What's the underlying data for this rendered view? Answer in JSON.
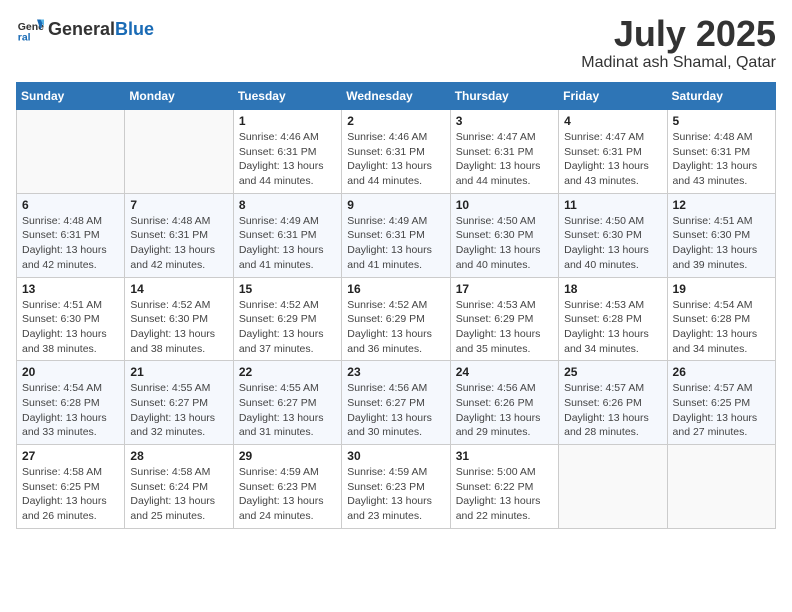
{
  "logo": {
    "general": "General",
    "blue": "Blue"
  },
  "title": {
    "month": "July 2025",
    "location": "Madinat ash Shamal, Qatar"
  },
  "weekdays": [
    "Sunday",
    "Monday",
    "Tuesday",
    "Wednesday",
    "Thursday",
    "Friday",
    "Saturday"
  ],
  "weeks": [
    [
      {
        "day": null
      },
      {
        "day": null
      },
      {
        "day": "1",
        "sunrise": "Sunrise: 4:46 AM",
        "sunset": "Sunset: 6:31 PM",
        "daylight": "Daylight: 13 hours and 44 minutes."
      },
      {
        "day": "2",
        "sunrise": "Sunrise: 4:46 AM",
        "sunset": "Sunset: 6:31 PM",
        "daylight": "Daylight: 13 hours and 44 minutes."
      },
      {
        "day": "3",
        "sunrise": "Sunrise: 4:47 AM",
        "sunset": "Sunset: 6:31 PM",
        "daylight": "Daylight: 13 hours and 44 minutes."
      },
      {
        "day": "4",
        "sunrise": "Sunrise: 4:47 AM",
        "sunset": "Sunset: 6:31 PM",
        "daylight": "Daylight: 13 hours and 43 minutes."
      },
      {
        "day": "5",
        "sunrise": "Sunrise: 4:48 AM",
        "sunset": "Sunset: 6:31 PM",
        "daylight": "Daylight: 13 hours and 43 minutes."
      }
    ],
    [
      {
        "day": "6",
        "sunrise": "Sunrise: 4:48 AM",
        "sunset": "Sunset: 6:31 PM",
        "daylight": "Daylight: 13 hours and 42 minutes."
      },
      {
        "day": "7",
        "sunrise": "Sunrise: 4:48 AM",
        "sunset": "Sunset: 6:31 PM",
        "daylight": "Daylight: 13 hours and 42 minutes."
      },
      {
        "day": "8",
        "sunrise": "Sunrise: 4:49 AM",
        "sunset": "Sunset: 6:31 PM",
        "daylight": "Daylight: 13 hours and 41 minutes."
      },
      {
        "day": "9",
        "sunrise": "Sunrise: 4:49 AM",
        "sunset": "Sunset: 6:31 PM",
        "daylight": "Daylight: 13 hours and 41 minutes."
      },
      {
        "day": "10",
        "sunrise": "Sunrise: 4:50 AM",
        "sunset": "Sunset: 6:30 PM",
        "daylight": "Daylight: 13 hours and 40 minutes."
      },
      {
        "day": "11",
        "sunrise": "Sunrise: 4:50 AM",
        "sunset": "Sunset: 6:30 PM",
        "daylight": "Daylight: 13 hours and 40 minutes."
      },
      {
        "day": "12",
        "sunrise": "Sunrise: 4:51 AM",
        "sunset": "Sunset: 6:30 PM",
        "daylight": "Daylight: 13 hours and 39 minutes."
      }
    ],
    [
      {
        "day": "13",
        "sunrise": "Sunrise: 4:51 AM",
        "sunset": "Sunset: 6:30 PM",
        "daylight": "Daylight: 13 hours and 38 minutes."
      },
      {
        "day": "14",
        "sunrise": "Sunrise: 4:52 AM",
        "sunset": "Sunset: 6:30 PM",
        "daylight": "Daylight: 13 hours and 38 minutes."
      },
      {
        "day": "15",
        "sunrise": "Sunrise: 4:52 AM",
        "sunset": "Sunset: 6:29 PM",
        "daylight": "Daylight: 13 hours and 37 minutes."
      },
      {
        "day": "16",
        "sunrise": "Sunrise: 4:52 AM",
        "sunset": "Sunset: 6:29 PM",
        "daylight": "Daylight: 13 hours and 36 minutes."
      },
      {
        "day": "17",
        "sunrise": "Sunrise: 4:53 AM",
        "sunset": "Sunset: 6:29 PM",
        "daylight": "Daylight: 13 hours and 35 minutes."
      },
      {
        "day": "18",
        "sunrise": "Sunrise: 4:53 AM",
        "sunset": "Sunset: 6:28 PM",
        "daylight": "Daylight: 13 hours and 34 minutes."
      },
      {
        "day": "19",
        "sunrise": "Sunrise: 4:54 AM",
        "sunset": "Sunset: 6:28 PM",
        "daylight": "Daylight: 13 hours and 34 minutes."
      }
    ],
    [
      {
        "day": "20",
        "sunrise": "Sunrise: 4:54 AM",
        "sunset": "Sunset: 6:28 PM",
        "daylight": "Daylight: 13 hours and 33 minutes."
      },
      {
        "day": "21",
        "sunrise": "Sunrise: 4:55 AM",
        "sunset": "Sunset: 6:27 PM",
        "daylight": "Daylight: 13 hours and 32 minutes."
      },
      {
        "day": "22",
        "sunrise": "Sunrise: 4:55 AM",
        "sunset": "Sunset: 6:27 PM",
        "daylight": "Daylight: 13 hours and 31 minutes."
      },
      {
        "day": "23",
        "sunrise": "Sunrise: 4:56 AM",
        "sunset": "Sunset: 6:27 PM",
        "daylight": "Daylight: 13 hours and 30 minutes."
      },
      {
        "day": "24",
        "sunrise": "Sunrise: 4:56 AM",
        "sunset": "Sunset: 6:26 PM",
        "daylight": "Daylight: 13 hours and 29 minutes."
      },
      {
        "day": "25",
        "sunrise": "Sunrise: 4:57 AM",
        "sunset": "Sunset: 6:26 PM",
        "daylight": "Daylight: 13 hours and 28 minutes."
      },
      {
        "day": "26",
        "sunrise": "Sunrise: 4:57 AM",
        "sunset": "Sunset: 6:25 PM",
        "daylight": "Daylight: 13 hours and 27 minutes."
      }
    ],
    [
      {
        "day": "27",
        "sunrise": "Sunrise: 4:58 AM",
        "sunset": "Sunset: 6:25 PM",
        "daylight": "Daylight: 13 hours and 26 minutes."
      },
      {
        "day": "28",
        "sunrise": "Sunrise: 4:58 AM",
        "sunset": "Sunset: 6:24 PM",
        "daylight": "Daylight: 13 hours and 25 minutes."
      },
      {
        "day": "29",
        "sunrise": "Sunrise: 4:59 AM",
        "sunset": "Sunset: 6:23 PM",
        "daylight": "Daylight: 13 hours and 24 minutes."
      },
      {
        "day": "30",
        "sunrise": "Sunrise: 4:59 AM",
        "sunset": "Sunset: 6:23 PM",
        "daylight": "Daylight: 13 hours and 23 minutes."
      },
      {
        "day": "31",
        "sunrise": "Sunrise: 5:00 AM",
        "sunset": "Sunset: 6:22 PM",
        "daylight": "Daylight: 13 hours and 22 minutes."
      },
      {
        "day": null
      },
      {
        "day": null
      }
    ]
  ]
}
